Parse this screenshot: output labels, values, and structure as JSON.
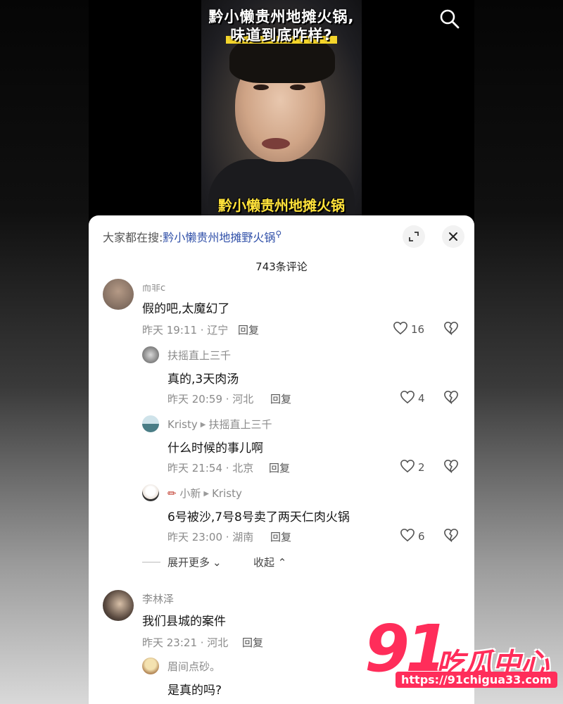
{
  "video": {
    "title_line1": "黔小懒贵州地摊火锅,",
    "title_line2": "味道到底咋样?",
    "subtitle": "黔小懒贵州地摊火锅"
  },
  "panel": {
    "search_prefix": "大家都在搜:",
    "search_keyword": "黔小懒贵州地摊野火锅",
    "comment_count": "743条评论",
    "expand_more": "展开更多",
    "collapse": "收起"
  },
  "comments": [
    {
      "user": "而非c",
      "text": "假的吧,太魔幻了",
      "meta": "昨天 19:11 · 辽宁",
      "reply": "回复",
      "likes": "16"
    },
    {
      "user": "扶摇直上三千",
      "text": "真的,3天肉汤",
      "meta": "昨天 20:59 · 河北",
      "reply": "回复",
      "likes": "4"
    },
    {
      "user": "Kristy",
      "reply_to": "扶摇直上三千",
      "text": "什么时候的事儿啊",
      "meta": "昨天 21:54 · 北京",
      "reply": "回复",
      "likes": "2"
    },
    {
      "user": "小新",
      "reply_to": "Kristy",
      "text": "6号被沙,7号8号卖了两天仁肉火锅",
      "meta": "昨天 23:00 · 湖南",
      "reply": "回复",
      "likes": "6"
    },
    {
      "user": "李林泽",
      "text": "我们县城的案件",
      "meta": "昨天 23:21 · 河北",
      "reply": "回复",
      "likes": ""
    },
    {
      "user": "眉间点砂。",
      "text": "是真的吗?",
      "meta": "",
      "reply": "",
      "likes": ""
    }
  ],
  "watermark": {
    "number": "91",
    "name": "吃瓜中心",
    "url": "https://91chigua33.com"
  },
  "colors": {
    "keyword": "#2f4fa8",
    "watermark": "#ff2d5a",
    "subtitle": "#ffe23a"
  }
}
